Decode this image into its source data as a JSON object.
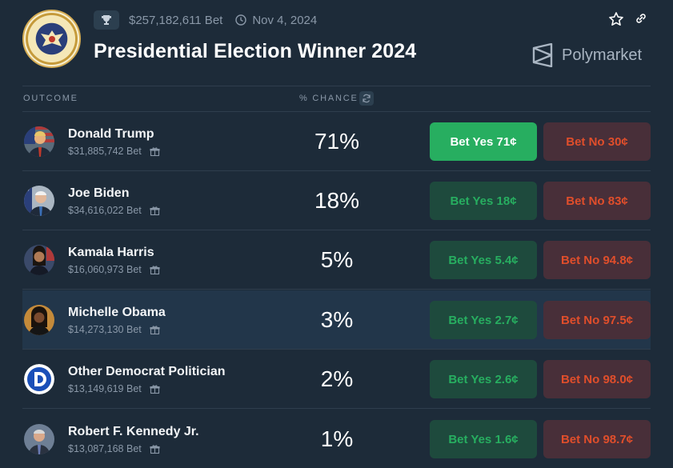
{
  "header": {
    "volume": "$257,182,611 Bet",
    "date": "Nov 4, 2024",
    "title": "Presidential Election Winner 2024",
    "brand": "Polymarket"
  },
  "columns": {
    "outcome": "OUTCOME",
    "chance": "% CHANCE"
  },
  "colors": {
    "background": "#1d2b39",
    "yes_active": "#27ae60",
    "yes": "#1e4a3d",
    "no": "#482f39",
    "no_text": "#e04e2b"
  },
  "rows": [
    {
      "name": "Donald Trump",
      "bet": "$31,885,742 Bet",
      "chance": "71%",
      "yes": "Bet Yes 71¢",
      "no": "Bet No 30¢"
    },
    {
      "name": "Joe Biden",
      "bet": "$34,616,022 Bet",
      "chance": "18%",
      "yes": "Bet Yes 18¢",
      "no": "Bet No 83¢"
    },
    {
      "name": "Kamala Harris",
      "bet": "$16,060,973 Bet",
      "chance": "5%",
      "yes": "Bet Yes 5.4¢",
      "no": "Bet No 94.8¢"
    },
    {
      "name": "Michelle Obama",
      "bet": "$14,273,130 Bet",
      "chance": "3%",
      "yes": "Bet Yes 2.7¢",
      "no": "Bet No 97.5¢"
    },
    {
      "name": "Other Democrat Politician",
      "bet": "$13,149,619 Bet",
      "chance": "2%",
      "yes": "Bet Yes 2.6¢",
      "no": "Bet No 98.0¢"
    },
    {
      "name": "Robert F. Kennedy Jr.",
      "bet": "$13,087,168 Bet",
      "chance": "1%",
      "yes": "Bet Yes 1.6¢",
      "no": "Bet No 98.7¢"
    }
  ]
}
